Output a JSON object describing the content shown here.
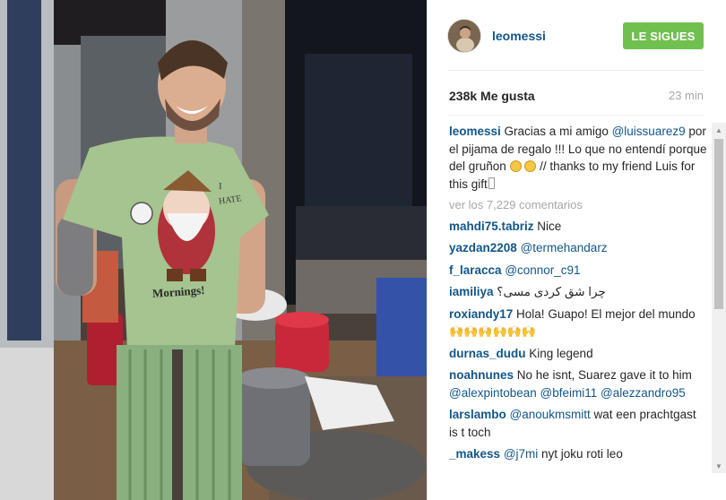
{
  "post": {
    "username": "leomessi",
    "follow_label": "LE SIGUES",
    "likes": "238k Me gusta",
    "time": "23 min",
    "caption_user": "leomessi",
    "caption_pre": " Gracias a mi amigo ",
    "caption_mention": "@luissuarez9",
    "caption_mid": " por el pijama de regalo !!! Lo que no entendí porque del gruñon ",
    "caption_post": " // thanks to my friend Luis for this gift",
    "view_more": "ver los 7,229 comentarios",
    "accent_color": "#125688",
    "follow_color": "#70c050"
  },
  "photo": {
    "shirt_text_1": "I",
    "shirt_text_2": "HATE",
    "shirt_text_3": "Mornings!"
  },
  "comments": [
    {
      "user": "mahdi75.tabriz",
      "mention": "",
      "text": " Nice"
    },
    {
      "user": "yazdan2208",
      "mention": " @termehandarz",
      "text": ""
    },
    {
      "user": "f_laracca",
      "mention": " @connor_c91",
      "text": ""
    },
    {
      "user": "iamiliya",
      "mention": "",
      "text": " چرا شق کردی مسی؟"
    },
    {
      "user": "roxiandy17",
      "mention": "",
      "text": " Hola! Guapo! El mejor del mundo"
    },
    {
      "user": "durnas_dudu",
      "mention": "",
      "text": " King legend"
    },
    {
      "user": "noahnunes",
      "mention": "",
      "text": " No he isnt, Suarez gave it to him "
    },
    {
      "user": "larslambo",
      "mention": " @anoukmsmitt",
      "text": " wat een prachtgast is t toch"
    },
    {
      "user": "_makess",
      "mention": " @j7mi",
      "text": " nyt joku roti leo"
    }
  ],
  "comment_extra": {
    "noah_mentions": [
      "@alexpintobean",
      "@bfeimi11",
      "@alezzandro95"
    ],
    "roxi_hands": "🙌🙌🙌🙌🙌🙌"
  },
  "icons": [
    "scroll-up-arrow-icon",
    "scroll-down-arrow-icon",
    "grin-emoji-icon"
  ]
}
